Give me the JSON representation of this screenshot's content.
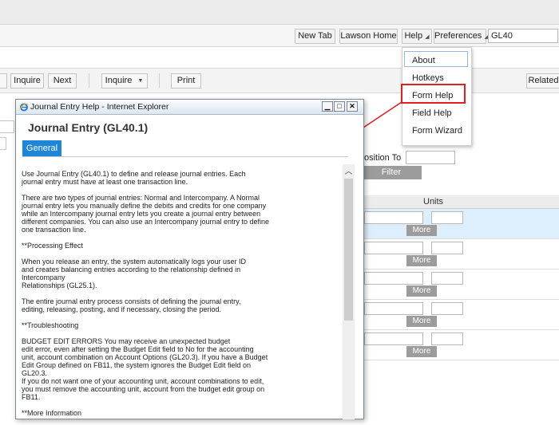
{
  "header": {
    "buttons": {
      "new_tab": "New Tab",
      "lawson_home": "Lawson Home",
      "help": "Help",
      "preferences": "Preferences"
    },
    "search_value": "GL40"
  },
  "help_menu": {
    "items": [
      "About",
      "Hotkeys",
      "Form Help",
      "Field Help",
      "Form Wizard"
    ],
    "highlight_color": "#e02020"
  },
  "toolbar": {
    "inquire_1": "Inquire",
    "next": "Next",
    "inquire_2": "Inquire",
    "print": "Print",
    "related": "Related"
  },
  "background_form": {
    "position_to_label": "osition To",
    "filter_label": "Filter",
    "units_header": "Units",
    "more_label": "More"
  },
  "help_window": {
    "title": "Journal Entry Help - Internet Explorer",
    "form_title": "Journal Entry (GL40.1)",
    "tab": "General",
    "accent_color": "#1e86d8",
    "paragraphs": [
      "Use Journal Entry (GL40.1) to define and release journal entries. Each\njournal entry must have at least one transaction line.",
      "There are two types of journal entries: Normal and Intercompany. A Normal\njournal entry lets you manually define the debits and credits for one company\nwhile an Intercompany journal entry lets you create a journal entry between\ndifferent companies. You can also use an Intercompany journal entry to define\none transaction line.",
      "**Processing Effect",
      "When you release an entry, the system automatically logs your user ID\nand creates balancing entries according to the relationship defined in\nIntercompany\nRelationships (GL25.1).",
      "The entire journal entry process consists of defining the journal entry,\nediting, releasing, posting, and if necessary, closing the period.",
      "**Troubleshooting",
      "BUDGET EDIT ERRORS You may receive an unexpected budget\nedit error, even after setting the Budget Edit field to No for the accounting\nunit, account combination on Account Options (GL20.3). If you have a Budget\nEdit Group defined on FB11, the system ignores the Budget Edit field on\nGL20.3.\nIf you do not want one of your accounting unit, account combinations to edit,\nyou must remove the accounting unit, account from the budget edit group on\nFB11.",
      "**More Information"
    ]
  }
}
